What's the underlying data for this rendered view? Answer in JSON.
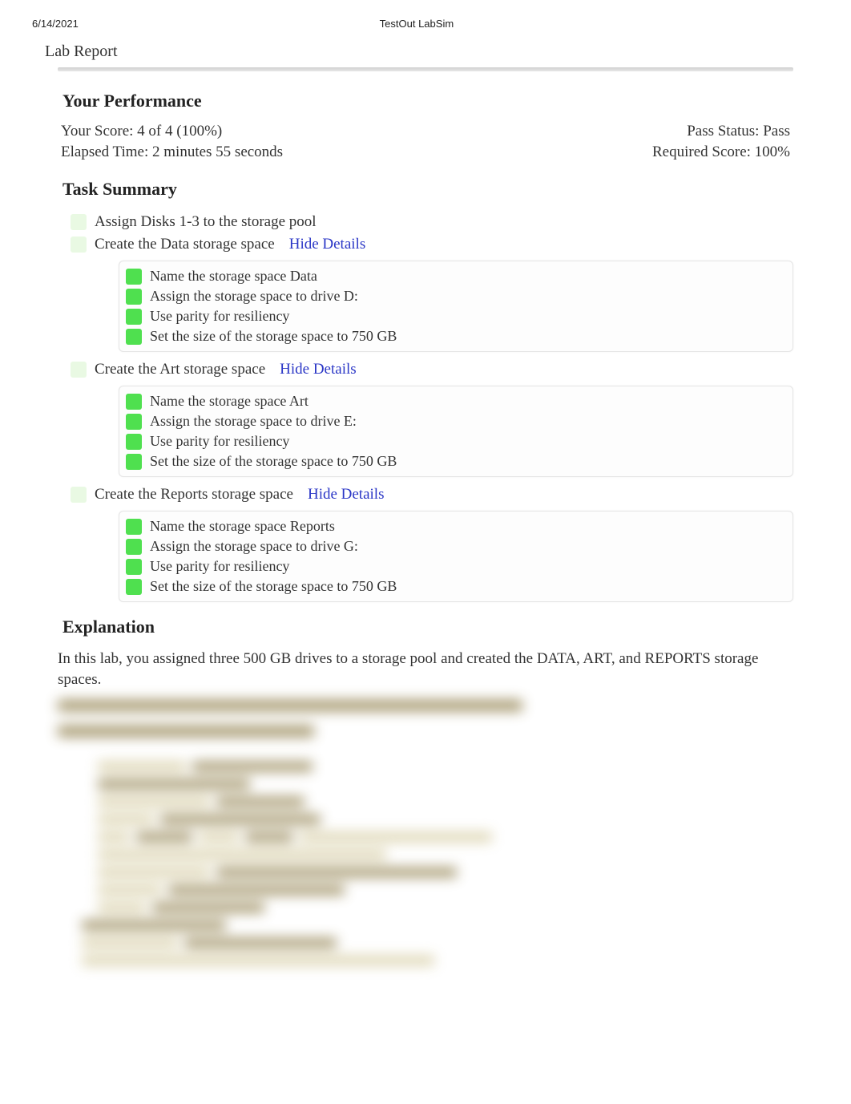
{
  "header": {
    "date": "6/14/2021",
    "app_title": "TestOut LabSim"
  },
  "report_title": "Lab Report",
  "performance": {
    "heading": "Your Performance",
    "score_label": "Your Score: 4 of 4 (100%)",
    "pass_label": "Pass Status: Pass",
    "elapsed_label": "Elapsed Time: 2 minutes 55 seconds",
    "required_label": "Required Score: 100%"
  },
  "task_summary": {
    "heading": "Task Summary",
    "hide_details_label": "Hide Details",
    "tasks": [
      {
        "label": "Assign Disks 1-3 to the storage pool",
        "has_details": false
      },
      {
        "label": "Create the Data storage space",
        "has_details": true,
        "subs": [
          "Name the storage space Data",
          "Assign the storage space to drive D:",
          "Use parity for resiliency",
          "Set the size of the storage space to 750 GB"
        ]
      },
      {
        "label": "Create the Art storage space",
        "has_details": true,
        "subs": [
          "Name the storage space Art",
          "Assign the storage space to drive E:",
          "Use parity for resiliency",
          "Set the size of the storage space to 750 GB"
        ]
      },
      {
        "label": "Create the Reports storage space",
        "has_details": true,
        "subs": [
          "Name the storage space Reports",
          "Assign the storage space to drive G:",
          "Use parity for resiliency",
          "Set the size of the storage space to 750 GB"
        ]
      }
    ]
  },
  "explanation": {
    "heading": "Explanation",
    "intro": "In this lab, you assigned three 500 GB drives to a storage pool and created the DATA, ART, and REPORTS storage spaces."
  }
}
